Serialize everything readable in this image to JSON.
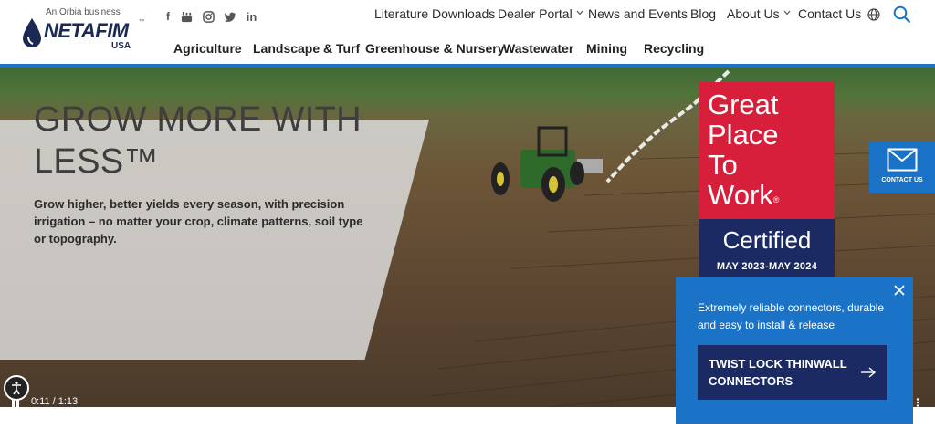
{
  "brand": {
    "tagline": "An Orbia business",
    "name": "NETAFIM",
    "trademark": "™",
    "country": "USA",
    "color": "#1b2a55"
  },
  "social": [
    "facebook-icon",
    "youtube-icon",
    "instagram-icon",
    "twitter-icon",
    "linkedin-icon"
  ],
  "utility_nav": [
    {
      "label": "Literature Downloads",
      "dropdown": false
    },
    {
      "label": "Dealer Portal",
      "dropdown": true
    },
    {
      "label": "News and Events",
      "dropdown": false
    },
    {
      "label": "Blog",
      "dropdown": false
    },
    {
      "label": "About Us",
      "dropdown": true
    },
    {
      "label": "Contact Us",
      "dropdown": false
    }
  ],
  "main_nav": [
    "Agriculture",
    "Landscape & Turf",
    "Greenhouse & Nursery",
    "Wastewater",
    "Mining",
    "Recycling"
  ],
  "hero": {
    "title": "GROW MORE WITH LESS™",
    "text": "Grow higher, better yields every season, with precision irrigation – no matter your crop, climate patterns, soil type or topography."
  },
  "badge": {
    "line1": "Great",
    "line2": "Place",
    "line3": "To",
    "line4": "Work",
    "registered": "®",
    "certified": "Certified",
    "dates": "MAY 2023-MAY 2024",
    "red": "#d71e3a",
    "navy": "#1c2a63"
  },
  "contact_tab": {
    "label": "CONTACT US"
  },
  "promo": {
    "text": "Extremely reliable connectors, durable and easy to install & release",
    "cta": "TWIST LOCK THINWALL CONNECTORS",
    "accent": "#1a73c7"
  },
  "video": {
    "time": "0:11 / 1:13"
  }
}
